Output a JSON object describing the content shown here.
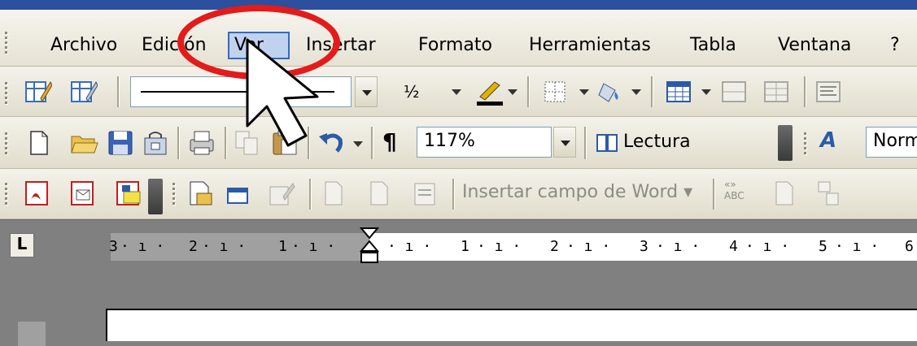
{
  "menu": {
    "items": [
      {
        "id": "archivo",
        "label": "Archivo"
      },
      {
        "id": "edicion",
        "label": "Edición"
      },
      {
        "id": "ver",
        "label": "Ver"
      },
      {
        "id": "insertar",
        "label": "Insertar"
      },
      {
        "id": "formato",
        "label": "Formato"
      },
      {
        "id": "herramientas",
        "label": "Herramientas"
      },
      {
        "id": "tabla",
        "label": "Tabla"
      },
      {
        "id": "ventana",
        "label": "Ventana"
      },
      {
        "id": "ayuda",
        "label": "?"
      }
    ]
  },
  "toolbar_drawing": {
    "line_weight_value": "½"
  },
  "toolbar_standard": {
    "zoom_value": "117%",
    "reading_button_label": "Lectura",
    "style_value": "Norm"
  },
  "toolbar_mailmerge": {
    "insert_word_field_label": "Insertar campo de Word"
  },
  "ruler": {
    "ticks": [
      "3",
      "2",
      "1",
      "1",
      "2",
      "3",
      "4",
      "5",
      "6"
    ]
  },
  "tab_selector_glyph": "L",
  "colors": {
    "highlight_border": "#316ac5",
    "annotation_red": "#e41b1b"
  }
}
